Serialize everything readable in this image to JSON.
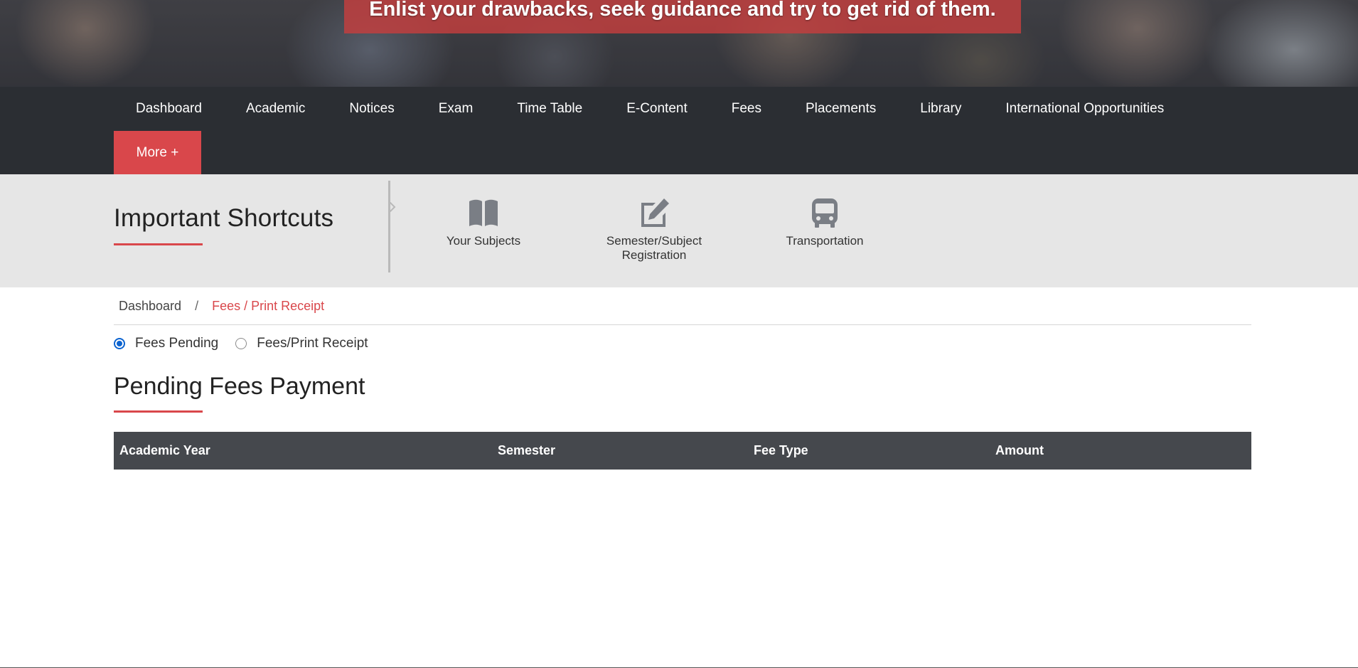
{
  "hero": {
    "caption": "Enlist your drawbacks, seek guidance and try to get rid of them."
  },
  "nav": {
    "items": [
      {
        "label": "Dashboard"
      },
      {
        "label": "Academic"
      },
      {
        "label": "Notices"
      },
      {
        "label": "Exam"
      },
      {
        "label": "Time Table"
      },
      {
        "label": "E-Content"
      },
      {
        "label": "Fees"
      },
      {
        "label": "Placements"
      },
      {
        "label": "Library"
      },
      {
        "label": "International Opportunities"
      }
    ],
    "more_label": "More +"
  },
  "shortcuts": {
    "title": "Important Shortcuts",
    "items": [
      {
        "label": "Your Subjects",
        "icon": "book-icon"
      },
      {
        "label_line1": "Semester/Subject",
        "label_line2": "Registration",
        "icon": "edit-icon"
      },
      {
        "label": "Transportation",
        "icon": "bus-icon"
      }
    ]
  },
  "breadcrumb": {
    "home": "Dashboard",
    "separator": "/",
    "current": "Fees / Print Receipt"
  },
  "radios": {
    "options": [
      {
        "label": "Fees Pending",
        "checked": true
      },
      {
        "label": "Fees/Print Receipt",
        "checked": false
      }
    ]
  },
  "section": {
    "title": "Pending Fees Payment"
  },
  "table": {
    "columns": [
      "Academic Year",
      "Semester",
      "Fee Type",
      "Amount"
    ],
    "rows": []
  },
  "colors": {
    "accent": "#d9474b",
    "nav_bg": "#2b2e33",
    "table_header_bg": "#45484d",
    "shortcuts_bg": "#e6e6e6",
    "radio_checked": "#0b63d0"
  }
}
